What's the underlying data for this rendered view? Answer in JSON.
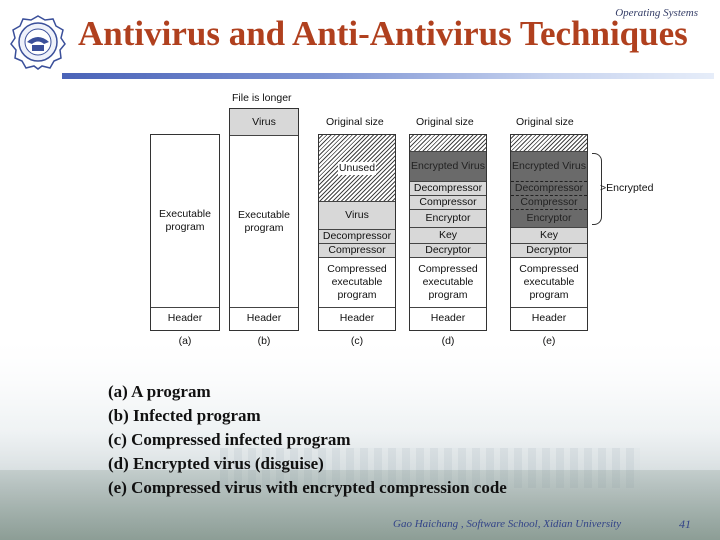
{
  "header": {
    "course": "Operating Systems",
    "title": "Antivirus and Anti-Antivirus Techniques",
    "logo_icon": "university-seal-icon"
  },
  "diagram": {
    "top_labels": {
      "file_is_longer": "File is longer",
      "original_size_c": "Original size",
      "original_size_d": "Original size",
      "original_size_e": "Original size"
    },
    "columns": [
      {
        "id": "a",
        "label": "(a)",
        "cells": [
          {
            "text": "Executable program",
            "style": "white"
          },
          {
            "text": "Header",
            "style": "white"
          }
        ]
      },
      {
        "id": "b",
        "label": "(b)",
        "cells": [
          {
            "text": "Virus",
            "style": "gray"
          },
          {
            "text": "Executable program",
            "style": "white"
          },
          {
            "text": "Header",
            "style": "white"
          }
        ]
      },
      {
        "id": "c",
        "label": "(c)",
        "cells": [
          {
            "text": "Unused",
            "style": "hatch"
          },
          {
            "text": "Virus",
            "style": "gray"
          },
          {
            "text": "Decompressor",
            "style": "gray"
          },
          {
            "text": "Compressor",
            "style": "gray"
          },
          {
            "text": "Compressed executable program",
            "style": "white"
          },
          {
            "text": "Header",
            "style": "white"
          }
        ]
      },
      {
        "id": "d",
        "label": "(d)",
        "cells": [
          {
            "text": "",
            "style": "hatch"
          },
          {
            "text": "Encrypted Virus",
            "style": "dark"
          },
          {
            "text": "Decompressor",
            "style": "gray"
          },
          {
            "text": "Compressor",
            "style": "gray"
          },
          {
            "text": "Encryptor",
            "style": "gray"
          },
          {
            "text": "Key",
            "style": "gray"
          },
          {
            "text": "Decryptor",
            "style": "gray"
          },
          {
            "text": "Compressed executable program",
            "style": "white"
          },
          {
            "text": "Header",
            "style": "white"
          }
        ]
      },
      {
        "id": "e",
        "label": "(e)",
        "cells": [
          {
            "text": "",
            "style": "hatch"
          },
          {
            "text": "Encrypted Virus",
            "style": "dark"
          },
          {
            "text": "Decompressor",
            "style": "dark"
          },
          {
            "text": "Compressor",
            "style": "dark"
          },
          {
            "text": "Encryptor",
            "style": "dark"
          },
          {
            "text": "Key",
            "style": "gray"
          },
          {
            "text": "Decryptor",
            "style": "gray"
          },
          {
            "text": "Compressed executable program",
            "style": "white"
          },
          {
            "text": "Header",
            "style": "white"
          }
        ]
      }
    ],
    "brace_label": ">Encrypted"
  },
  "captions": [
    "(a) A program",
    "(b) Infected  program",
    "(c) Compressed infected program",
    "(d) Encrypted virus (disguise)",
    "(e) Compressed virus with encrypted compression code"
  ],
  "footer": {
    "author": "Gao Haichang ,  Software School,  Xidian University",
    "page": "41"
  }
}
